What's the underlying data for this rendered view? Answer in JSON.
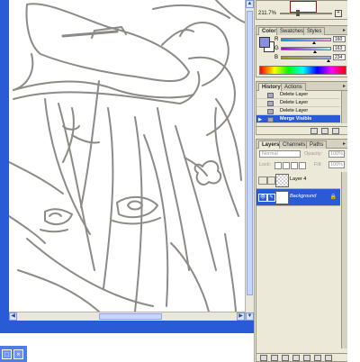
{
  "navigator": {
    "zoom": "211.7%"
  },
  "color_panel": {
    "tabs": [
      "Color",
      "Swatches",
      "Styles"
    ],
    "active_tab": "Color",
    "channels": [
      {
        "label": "R",
        "value": "160"
      },
      {
        "label": "G",
        "value": "163"
      },
      {
        "label": "B",
        "value": "234"
      }
    ],
    "foreground": "#a0a3ea",
    "background": "#ffffff"
  },
  "history_panel": {
    "tabs": [
      "History",
      "Actions"
    ],
    "active_tab": "History",
    "items": [
      {
        "label": "Delete Layer"
      },
      {
        "label": "Delete Layer"
      },
      {
        "label": "Delete Layer"
      },
      {
        "label": "Merge Visible",
        "selected": true
      }
    ]
  },
  "layers_panel": {
    "tabs": [
      "Layers",
      "Channels",
      "Paths"
    ],
    "active_tab": "Layers",
    "blend_mode": "Normal",
    "opacity_label": "Opacity:",
    "opacity": "100%",
    "lock_label": "Lock:",
    "fill_label": "Fill:",
    "fill": "100%",
    "layers": [
      {
        "name": "Layer 4",
        "selected": false,
        "visible": false
      },
      {
        "name": "Background",
        "selected": true,
        "visible": true,
        "locked": true
      }
    ]
  },
  "colors": {
    "title_blue": "#2a5bd7",
    "selection": "#2a5bd7",
    "panel_bg": "#ece9d8"
  },
  "icons": [
    "scroll-up-arrow",
    "scroll-down-arrow",
    "scroll-left-arrow",
    "scroll-right-arrow",
    "restore-icon",
    "close-icon",
    "eye-icon",
    "brush-icon",
    "lock-icon",
    "zoom-in-icon",
    "panel-menu-icon"
  ]
}
